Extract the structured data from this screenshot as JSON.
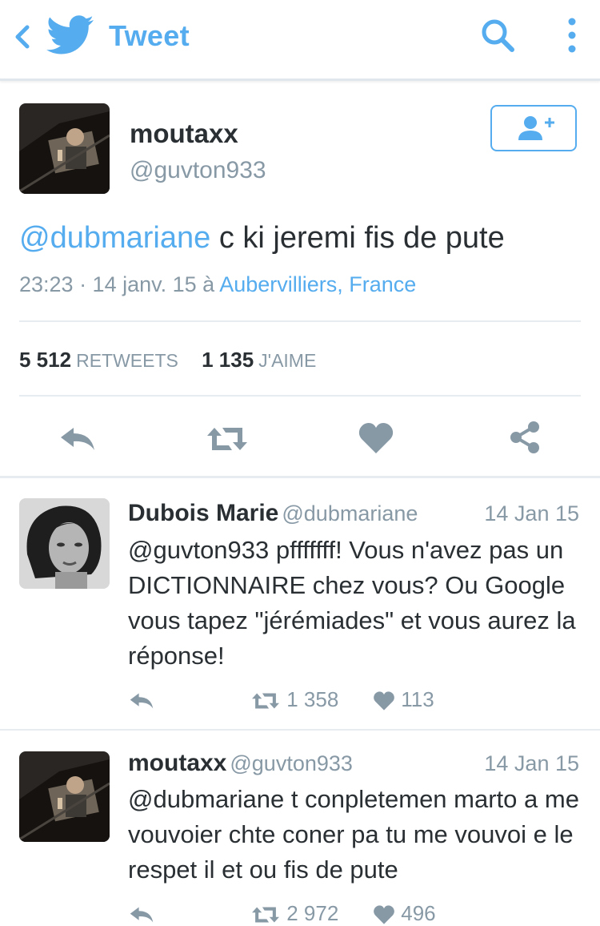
{
  "header": {
    "title": "Tweet"
  },
  "main_tweet": {
    "name": "moutaxx",
    "handle": "@guvton933",
    "mention": "@dubmariane",
    "body": " c ki jeremi fis de pute",
    "time_date": "23:23 · 14 janv. 15 à ",
    "location": "Aubervilliers, France",
    "retweets_count": "5 512",
    "retweets_label": "RETWEETS",
    "likes_count": "1 135",
    "likes_label": "J'AIME"
  },
  "replies": [
    {
      "name": "Dubois Marie",
      "handle": "@dubmariane",
      "date": "14 Jan 15",
      "text": "@guvton933 pfffffff! Vous n'avez pas un DICTIONNAIRE chez vous? Ou Google vous tapez \"jérémiades\" et vous aurez la réponse!",
      "retweets": "1 358",
      "likes": "113"
    },
    {
      "name": "moutaxx",
      "handle": "@guvton933",
      "date": "14 Jan 15",
      "text": "@dubmariane t conpletemen marto a me vouvoier chte coner pa tu me vouvoi e le respet il et ou fis de pute",
      "retweets": "2 972",
      "likes": "496"
    }
  ],
  "colors": {
    "accent": "#55acee",
    "text": "#292f33",
    "muted": "#8899a6",
    "icon": "#8899a6"
  }
}
